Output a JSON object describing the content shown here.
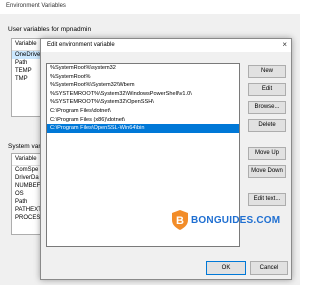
{
  "background_window": {
    "title": "Environment Variables",
    "user_section_label": "User variables for mpnadmin",
    "user_list": {
      "column_header": "Variable",
      "rows": [
        "OneDrive",
        "Path",
        "TEMP",
        "TMP"
      ],
      "selected_index": 0
    },
    "system_section_label": "System var",
    "system_list": {
      "column_header": "Variable",
      "rows": [
        "ComSpe",
        "DriverDa",
        "NUMBEF",
        "OS",
        "Path",
        "PATHEXT",
        "PROCESS"
      ]
    }
  },
  "dialog": {
    "title": "Edit environment variable",
    "close_glyph": "×",
    "paths": [
      "%SystemRoot%\\system32",
      "%SystemRoot%",
      "%SystemRoot%\\System32\\Wbem",
      "%SYSTEMROOT%\\System32\\WindowsPowerShell\\v1.0\\",
      "%SYSTEMROOT%\\System32\\OpenSSH\\",
      "C:\\Program Files\\dotnet\\",
      "C:\\Program Files (x86)\\dotnet\\",
      "C:\\Program Files\\OpenSSL-Win64\\bin"
    ],
    "selected_path_index": 7,
    "buttons": {
      "new": "New",
      "edit": "Edit",
      "browse": "Browse...",
      "delete": "Delete",
      "move_up": "Move Up",
      "move_down": "Move Down",
      "edit_text": "Edit text...",
      "ok": "OK",
      "cancel": "Cancel"
    }
  },
  "watermark": {
    "text": "BONGUIDES.COM",
    "icon": "shield-b-icon"
  },
  "colors": {
    "selection": "#0078d7",
    "watermark_orange": "#f28c28",
    "watermark_blue": "#1f6fd1"
  }
}
